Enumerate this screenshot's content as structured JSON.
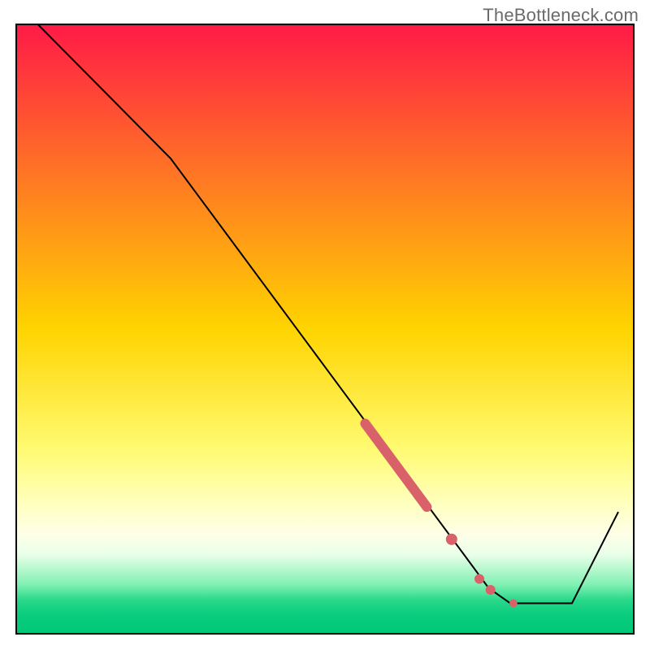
{
  "watermark": "TheBottleneck.com",
  "chart_data": {
    "type": "line",
    "title": "",
    "xlabel": "",
    "ylabel": "",
    "xlim": [
      0,
      100
    ],
    "ylim": [
      0,
      100
    ],
    "grid": false,
    "background_gradient_stops": [
      {
        "offset": 0.0,
        "color": "#ff1a47"
      },
      {
        "offset": 0.5,
        "color": "#ffd400"
      },
      {
        "offset": 0.7,
        "color": "#fffb74"
      },
      {
        "offset": 0.78,
        "color": "#ffffb8"
      },
      {
        "offset": 0.835,
        "color": "#ffffe7"
      },
      {
        "offset": 0.87,
        "color": "#e9ffe9"
      },
      {
        "offset": 0.92,
        "color": "#7ff0b2"
      },
      {
        "offset": 0.945,
        "color": "#28d889"
      },
      {
        "offset": 0.97,
        "color": "#0acc7e"
      },
      {
        "offset": 1.0,
        "color": "#00c878"
      }
    ],
    "inner_box": {
      "x": 2.5,
      "y": 3.75,
      "w": 95,
      "h": 93.75
    },
    "series": [
      {
        "name": "bottleneck-curve",
        "stroke": "#000000",
        "stroke_width": 2,
        "x": [
          3.5,
          25.0,
          72.5,
          76.5,
          80.0,
          85.0,
          90.0,
          97.5
        ],
        "y": [
          100.0,
          78.0,
          13.0,
          7.5,
          5.0,
          5.0,
          5.0,
          20.0
        ]
      }
    ],
    "markers": {
      "color": "#d9626a",
      "large_radius": 7,
      "small_radius": 5,
      "thick_segment": {
        "x_start": 56.5,
        "y_start": 34.5,
        "x_end": 66.5,
        "y_end": 20.8,
        "width": 12
      },
      "dots": [
        {
          "x": 70.5,
          "y": 15.5,
          "r": 7
        },
        {
          "x": 75.0,
          "y": 9.0,
          "r": 6
        },
        {
          "x": 76.8,
          "y": 7.2,
          "r": 6
        },
        {
          "x": 80.5,
          "y": 5.0,
          "r": 5
        }
      ]
    }
  }
}
